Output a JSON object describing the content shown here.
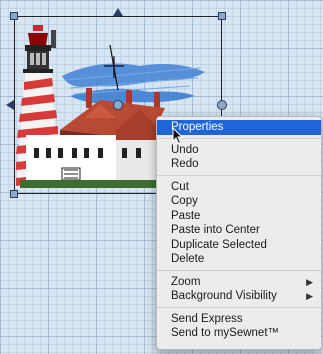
{
  "context_menu": {
    "items": [
      {
        "label": "Properties",
        "active": true
      },
      {
        "label": "Undo"
      },
      {
        "label": "Redo"
      },
      {
        "label": "Cut"
      },
      {
        "label": "Copy"
      },
      {
        "label": "Paste"
      },
      {
        "label": "Paste into Center"
      },
      {
        "label": "Duplicate Selected"
      },
      {
        "label": "Delete"
      },
      {
        "label": "Zoom",
        "submenu": true
      },
      {
        "label": "Background Visibility",
        "submenu": true
      },
      {
        "label": "Send Express"
      },
      {
        "label": "Send to mySewnet™"
      }
    ],
    "submenu_icon": "triangle-right-icon"
  },
  "colors": {
    "canvas": "#d6e5f1",
    "menu_highlight": "#1f64d8",
    "handle": "#8ea7c6"
  }
}
